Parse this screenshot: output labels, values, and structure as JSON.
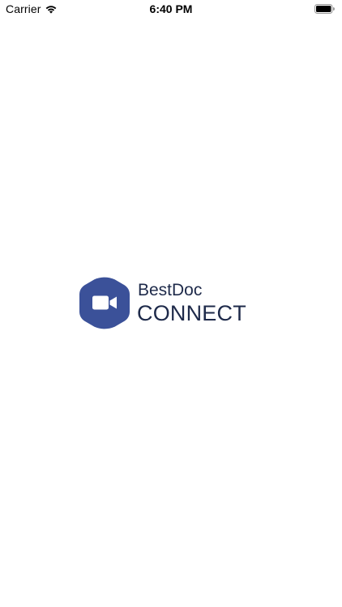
{
  "status_bar": {
    "carrier": "Carrier",
    "time": "6:40 PM",
    "wifi_icon": "wifi-icon",
    "battery_icon": "battery-icon"
  },
  "splash": {
    "brand_name": "BestDoc",
    "brand_product": "CONNECT",
    "logo_icon": "video-camera-icon",
    "logo_color": "#3b5199",
    "text_color": "#1e2a4a"
  }
}
